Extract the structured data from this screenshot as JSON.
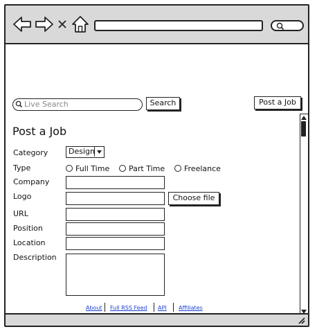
{
  "search": {
    "placeholder": "Live Search",
    "button_label": "Search"
  },
  "header": {
    "post_job_button": "Post a Job"
  },
  "form": {
    "title": "Post a Job",
    "category": {
      "label": "Category",
      "selected": "Design"
    },
    "type": {
      "label": "Type",
      "options": [
        "Full Time",
        "Part Time",
        "Freelance"
      ]
    },
    "company_label": "Company",
    "logo_label": "Logo",
    "choose_file_label": "Choose file",
    "url_label": "URL",
    "position_label": "Position",
    "location_label": "Location",
    "description_label": "Description"
  },
  "footer": {
    "links": [
      "About",
      "Full RSS Feed",
      "API",
      "Affiliates"
    ]
  },
  "icons": [
    "back-arrow-icon",
    "forward-arrow-icon",
    "close-icon",
    "home-icon",
    "search-icon",
    "chevron-down-icon",
    "resize-grip-icon"
  ]
}
